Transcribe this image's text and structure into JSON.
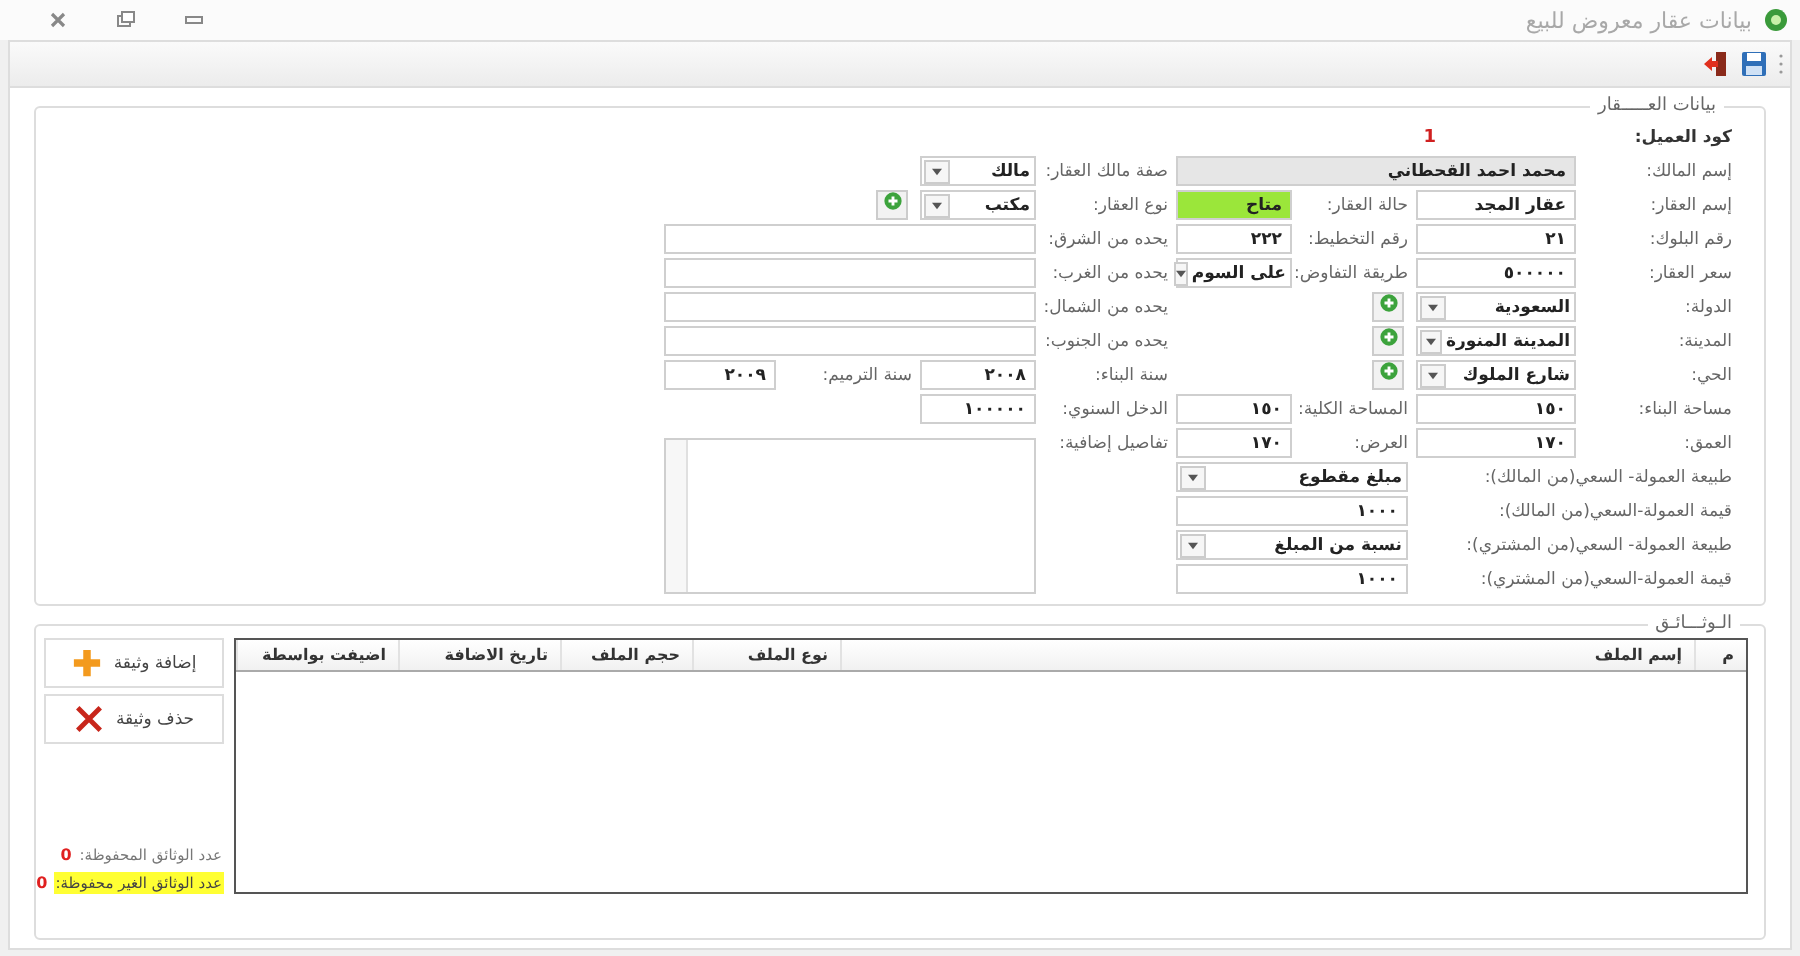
{
  "window": {
    "title": "بيانات عقار معروض للبيع"
  },
  "toolbar": [
    {
      "kind": "save"
    },
    {
      "kind": "exit"
    }
  ],
  "property_panel": {
    "title": "بيانات العـــــقار",
    "customer_code": {
      "label": "كود العميل:",
      "value": "1"
    },
    "fields": [
      {
        "label": "إسم المالك:",
        "value": "محمد احمد القحطاني",
        "kind": "readonly"
      },
      {
        "label": "صفة مالك العقار:",
        "value": "مالك",
        "kind": "dropdown"
      },
      {
        "label": "إسم العقار:",
        "value": "عقار المجد",
        "kind": "text"
      },
      {
        "label": "حالة العقار:",
        "value": "متاح",
        "kind": "status"
      },
      {
        "label": "نوع العقار:",
        "value": "مكتب",
        "kind": "dropdown_add"
      },
      {
        "label": "رقم البلوك:",
        "value": "٢١",
        "kind": "text"
      },
      {
        "label": "رقم التخطيط:",
        "value": "٢٢٢",
        "kind": "text"
      },
      {
        "label": "يحده من الشرق:",
        "kind": "text"
      },
      {
        "label": "سعر العقار:",
        "value": "٥٠٠٠٠٠",
        "kind": "text"
      },
      {
        "label": "طريقة التفاوض:",
        "value": "على السوم",
        "kind": "dropdown"
      },
      {
        "label": "يحده من الغرب:",
        "kind": "text"
      },
      {
        "label": "الدولة:",
        "value": "السعودية",
        "kind": "dropdown_add"
      },
      {
        "label": "يحده من الشمال:",
        "kind": "text"
      },
      {
        "label": "المدينة:",
        "value": "المدينة المنورة",
        "kind": "dropdown_add"
      },
      {
        "label": "يحده من الجنوب:",
        "kind": "text"
      },
      {
        "label": "الحي:",
        "value": "شارع الملوك",
        "kind": "dropdown_add"
      },
      {
        "label": "سنة البناء:",
        "value": "٢٠٠٨",
        "kind": "text"
      },
      {
        "label": "سنة الترميم:",
        "value": "٢٠٠٩",
        "kind": "text"
      },
      {
        "label": "مساحة البناء:",
        "value": "١٥٠",
        "kind": "text"
      },
      {
        "label": "المساحة الكلية:",
        "value": "١٥٠",
        "kind": "text"
      },
      {
        "label": "الدخل السنوي:",
        "value": "١٠٠٠٠٠",
        "kind": "text"
      },
      {
        "label": "العمق:",
        "value": "١٧٠",
        "kind": "text"
      },
      {
        "label": "العرض:",
        "value": "١٧٠",
        "kind": "text"
      },
      {
        "label": "تفاصيل إضافية:",
        "kind": "textarea"
      },
      {
        "label": "طبيعة العمولة- السعي(من المالك):",
        "value": "مبلغ مقطوع",
        "kind": "dropdown"
      },
      {
        "label": "قيمة العمولة-السعي(من المالك):",
        "value": "١٠٠٠",
        "kind": "text"
      },
      {
        "label": "طبيعة العمولة- السعي(من المشتري):",
        "value": "نسبة من المبلغ",
        "kind": "dropdown"
      },
      {
        "label": "قيمة العمولة-السعي(من المشتري):",
        "value": "١٠٠٠",
        "kind": "text"
      }
    ]
  },
  "documents": {
    "title": "الـوثـــائـق",
    "table": {
      "columns": [
        "م",
        "إسم الملف",
        "نوع الملف",
        "حجم الملف",
        "تاريخ الاضافة",
        "اضيفت بواسطة"
      ]
    },
    "buttons": [
      {
        "label": "إضافة وثيقة",
        "kind": "add"
      },
      {
        "label": "حذف وثيقة",
        "kind": "delete"
      }
    ],
    "counts": [
      {
        "label": "عدد الوثائق المحفوظة:",
        "value": "0",
        "highlighted": false
      },
      {
        "label": "عدد الوثائق الغير محفوظة:",
        "value": "0",
        "highlighted": true
      }
    ]
  }
}
